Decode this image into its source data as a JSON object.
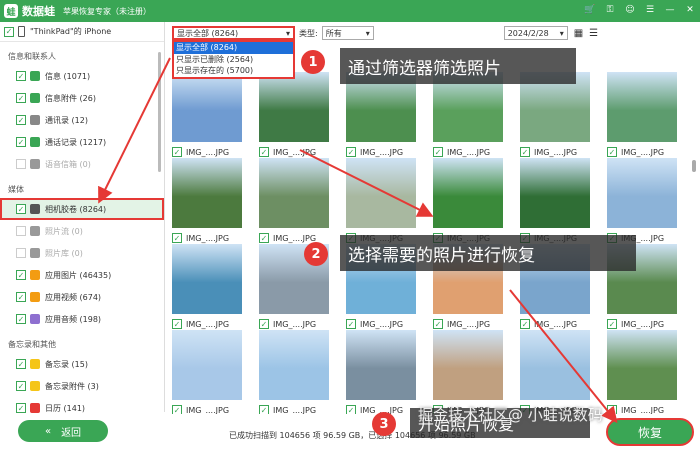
{
  "app": {
    "name": "数据蛙",
    "subtitle": "苹果恢复专家（未注册）"
  },
  "device": {
    "name": "\"ThinkPad\"的 iPhone"
  },
  "sidebar": {
    "sections": [
      {
        "title": "信息和联系人",
        "items": [
          {
            "label": "信息 (1071)",
            "checked": true,
            "icon_color": "#3aa655"
          },
          {
            "label": "信息附件 (26)",
            "checked": true,
            "icon_color": "#3aa655"
          },
          {
            "label": "通讯录 (12)",
            "checked": true,
            "icon_color": "#888"
          },
          {
            "label": "通话记录 (1217)",
            "checked": true,
            "icon_color": "#3aa655"
          },
          {
            "label": "语音信箱 (0)",
            "checked": false,
            "icon_color": "#999"
          }
        ]
      },
      {
        "title": "媒体",
        "items": [
          {
            "label": "相机胶卷 (8264)",
            "checked": true,
            "icon_color": "#555"
          },
          {
            "label": "照片流 (0)",
            "checked": false,
            "icon_color": "#999"
          },
          {
            "label": "照片库 (0)",
            "checked": false,
            "icon_color": "#999"
          },
          {
            "label": "应用图片 (46435)",
            "checked": true,
            "icon_color": "#f39c12"
          },
          {
            "label": "应用视频 (674)",
            "checked": true,
            "icon_color": "#f39c12"
          },
          {
            "label": "应用音频 (198)",
            "checked": true,
            "icon_color": "#8e6fd0"
          }
        ]
      },
      {
        "title": "备忘录和其他",
        "items": [
          {
            "label": "备忘录 (15)",
            "checked": true,
            "icon_color": "#f5c518"
          },
          {
            "label": "备忘录附件 (3)",
            "checked": true,
            "icon_color": "#f5c518"
          },
          {
            "label": "日历 (141)",
            "checked": true,
            "icon_color": "#e53935"
          }
        ]
      }
    ],
    "back_label": "返回"
  },
  "filter": {
    "show_value": "显示全部 (8264)",
    "type_label": "类型:",
    "type_value": "所有",
    "date_value": "2024/2/28",
    "options": [
      "显示全部 (8264)",
      "只显示已删除 (2564)",
      "只显示存在的 (5700)"
    ]
  },
  "photos": {
    "caption": "IMG_....JPG",
    "rows": [
      [
        "#6f9bd1",
        "#3f7a45",
        "#4d8f4f",
        "#5aa05c",
        "#7aa880",
        "#5d9c6e"
      ],
      [
        "#4c7a3e",
        "#6d8f63",
        "#a8b8a0",
        "#3a8a3a",
        "#2f6e35",
        "#8cb3d8"
      ],
      [
        "#4a8fb8",
        "#8a9aa8",
        "#6fb0d8",
        "#e0a070",
        "#7aa5cc",
        "#5a8a4f"
      ],
      [
        "#a8c8e8",
        "#9cc4e6",
        "#7a8fa0",
        "#c0a080",
        "#9ac0e0",
        "#5f8f50"
      ]
    ]
  },
  "annotations": {
    "step1": {
      "num": "1",
      "text": "通过筛选器筛选照片"
    },
    "step2": {
      "num": "2",
      "text": "选择需要的照片进行恢复"
    },
    "step3": {
      "num": "3",
      "text": "开始照片恢复"
    }
  },
  "status": {
    "text": "已成功扫描到 104656 项 96.59 GB，已选择 104656 项 96.59 GB"
  },
  "recover_label": "恢复",
  "watermark": "掘金技术社区@ 小蛙说数码",
  "colors": {
    "brand": "#3aa655",
    "highlight": "#e53935",
    "select_blue": "#1e6fd9"
  }
}
